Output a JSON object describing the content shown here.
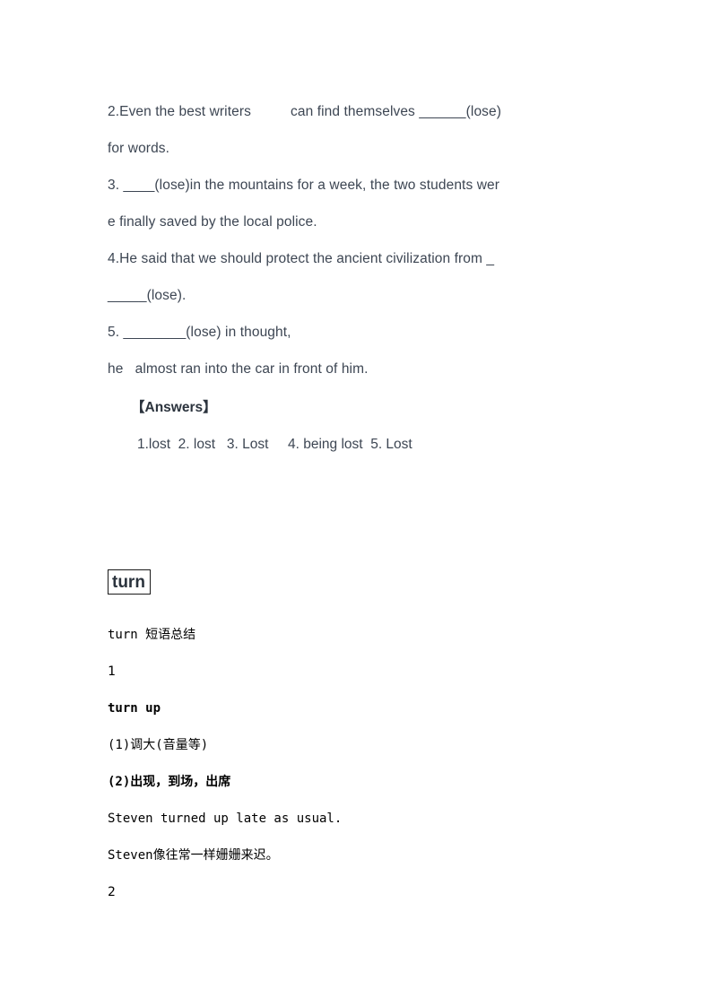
{
  "document": {
    "background_color": "#ffffff",
    "body_text_color": "#3d4653",
    "mono_text_color": "#000000",
    "border_color": "#1a1a1a"
  },
  "exercise": {
    "lines": [
      "    2.Even the best writers          can find themselves ______(lose)",
      "for words.",
      "    3. ____(lose)in the mountains for a week, the two students wer",
      "e finally saved by the local police.",
      "    4.He said that we should protect the ancient civilization from _",
      "_____(lose).",
      "    5. ________(lose) in thought,",
      "he   almost ran into the car in front of him."
    ],
    "line_1": "2.Even the best writers          can find themselves ______(lose)",
    "line_2": "for words.",
    "line_3": "3. ____(lose)in the mountains for a week, the two students wer",
    "line_4": "e finally saved by the local police.",
    "line_5": "4.He said that we should protect the ancient civilization from _",
    "line_6": "_____(lose).",
    "line_7": "5. ________(lose) in thought,",
    "line_8": "he   almost ran into the car in front of him."
  },
  "answers": {
    "heading": "【Answers】",
    "line": "1.lost  2. lost   3. Lost     4. being lost  5. Lost"
  },
  "vocab_section": {
    "boxed_word": "turn",
    "summary_title": "turn 短语总结",
    "items": [
      {
        "number": "1",
        "phrase": "turn up",
        "sense_1": "(1)调大(音量等)",
        "sense_2": "(2)出现，到场，出席",
        "example_en": "Steven turned up late as usual.",
        "example_zh": "Steven像往常一样姗姗来迟。"
      }
    ],
    "next_number": "2"
  }
}
